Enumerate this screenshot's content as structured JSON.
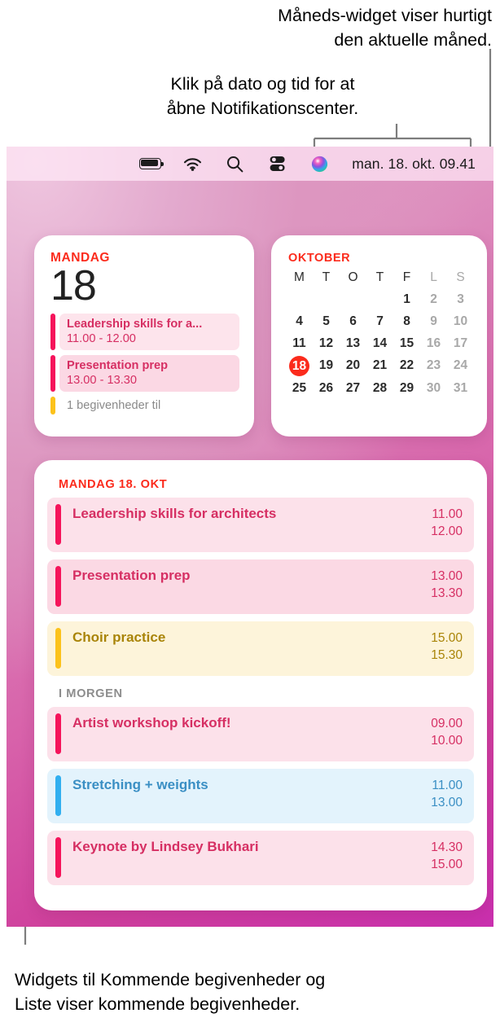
{
  "callouts": {
    "month_widget": "Måneds-widget viser hurtigt\nden aktuelle måned.",
    "notification_center": "Klik på dato og tid for at\nåbne Notifikationscenter.",
    "bottom": "Widgets til Kommende begivenheder og\nListe viser kommende begivenheder."
  },
  "menubar": {
    "icons": [
      {
        "name": "battery-icon",
        "glyph": "battery"
      },
      {
        "name": "wifi-icon",
        "glyph": "wifi"
      },
      {
        "name": "search-icon",
        "glyph": "search"
      },
      {
        "name": "control-center-icon",
        "glyph": "control-center"
      },
      {
        "name": "siri-icon",
        "glyph": "siri"
      }
    ],
    "clock": "man. 18. okt.  09.41"
  },
  "day_widget": {
    "weekday": "MANDAG",
    "day_number": "18",
    "events": [
      {
        "title": "Leadership skills for a...",
        "time": "11.00 - 12.00",
        "color": "#f5145b",
        "bg": "#fde4ec",
        "text": "#d62f63"
      },
      {
        "title": "Presentation prep",
        "time": "13.00 - 13.30",
        "color": "#f5145b",
        "bg": "#fbd8e4",
        "text": "#d62f63"
      }
    ],
    "more_label": "1 begivenheder til",
    "more_color": "#fcc21b"
  },
  "month_widget": {
    "title": "OKTOBER",
    "weekday_headers": [
      "M",
      "T",
      "O",
      "T",
      "F",
      "L",
      "S"
    ],
    "weekend_columns": [
      5,
      6
    ],
    "leading_blanks": 4,
    "days": [
      1,
      2,
      3,
      4,
      5,
      6,
      7,
      8,
      9,
      10,
      11,
      12,
      13,
      14,
      15,
      16,
      17,
      18,
      19,
      20,
      21,
      22,
      23,
      24,
      25,
      26,
      27,
      28,
      29,
      30,
      31
    ],
    "today": 18,
    "today_color": "#fb2b1c"
  },
  "list_widget": {
    "sections": [
      {
        "header": "MANDAG 18. OKT",
        "header_style": "today",
        "events": [
          {
            "title": "Leadership skills for architects",
            "start": "11.00",
            "end": "12.00",
            "color": "#f5145b",
            "bg": "#fce1ea",
            "text": "#d62f63"
          },
          {
            "title": "Presentation prep",
            "start": "13.00",
            "end": "13.30",
            "color": "#f5145b",
            "bg": "#fbd9e4",
            "text": "#d62f63"
          },
          {
            "title": "Choir practice",
            "start": "15.00",
            "end": "15.30",
            "color": "#fcc21b",
            "bg": "#fdf4da",
            "text": "#a98408"
          }
        ]
      },
      {
        "header": "I MORGEN",
        "header_style": "tomorrow",
        "events": [
          {
            "title": "Artist workshop kickoff!",
            "start": "09.00",
            "end": "10.00",
            "color": "#f5145b",
            "bg": "#fce1ea",
            "text": "#d62f63"
          },
          {
            "title": "Stretching + weights",
            "start": "11.00",
            "end": "13.00",
            "color": "#31aff0",
            "bg": "#e3f3fc",
            "text": "#3a8fc4"
          },
          {
            "title": "Keynote by Lindsey Bukhari",
            "start": "14.30",
            "end": "15.00",
            "color": "#f5145b",
            "bg": "#fce1ea",
            "text": "#d62f63"
          }
        ]
      }
    ]
  }
}
